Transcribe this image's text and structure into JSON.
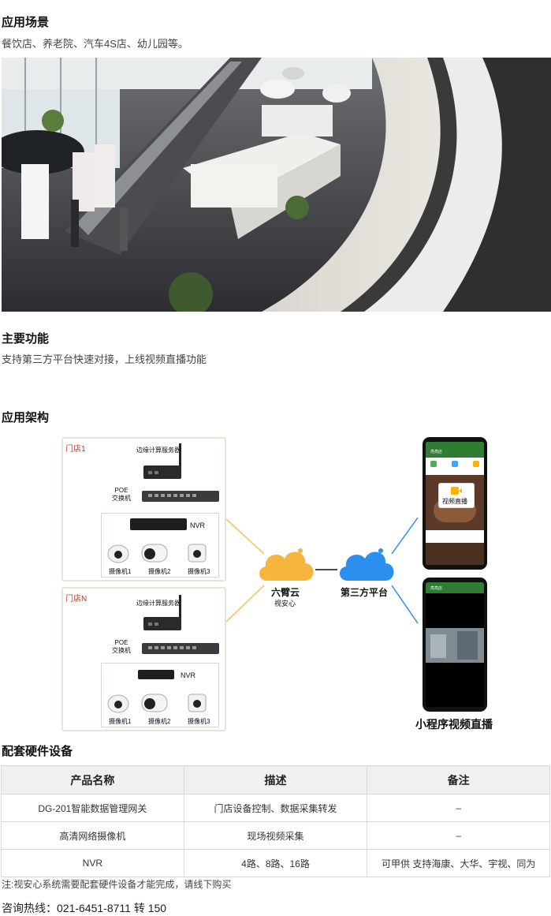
{
  "scene": {
    "title": "应用场景",
    "desc": "餐饮店、养老院、汽车4S店、幼儿园等。"
  },
  "feature": {
    "title": "主要功能",
    "desc": "支持第三方平台快速对接，上线视频直播功能"
  },
  "arch": {
    "title": "应用架构",
    "store1": {
      "label": "门店1",
      "server": "边缘计算服务器",
      "poe1": "POE",
      "poe2": "交换机",
      "nvr": "NVR",
      "cams": [
        "摄像机1",
        "摄像机2",
        "摄像机3"
      ]
    },
    "storeN": {
      "label": "门店N",
      "server": "边缘计算服务器",
      "poe1": "POE",
      "poe2": "交换机",
      "nvr": "NVR",
      "cams": [
        "摄像机1",
        "摄像机2",
        "摄像机3"
      ]
    },
    "cloud1": {
      "name": "六臂云",
      "sub": "视安心",
      "color": "#f6b53d"
    },
    "cloud2": {
      "name": "第三方平台",
      "color": "#2b8ff0"
    },
    "phone1": {
      "title": "视频直播",
      "bar": "亮亮店"
    },
    "phone2": {
      "bar": "亮亮店"
    },
    "miniprogram": "小程序视频直播"
  },
  "hardware": {
    "title": "配套硬件设备",
    "headers": [
      "产品名称",
      "描述",
      "备注"
    ],
    "rows": [
      [
        "DG-201智能数据管理网关",
        "门店设备控制、数据采集转发",
        "–"
      ],
      [
        "高清网络摄像机",
        "现场视频采集",
        "–"
      ],
      [
        "NVR",
        "4路、8路、16路",
        "可甲供 支持海康、大华、宇视、同为"
      ]
    ]
  },
  "note": "注:视安心系统需要配套硬件设备才能完成，请线下购买",
  "hotline": "咨询热线：021-6451-8711 转 150"
}
